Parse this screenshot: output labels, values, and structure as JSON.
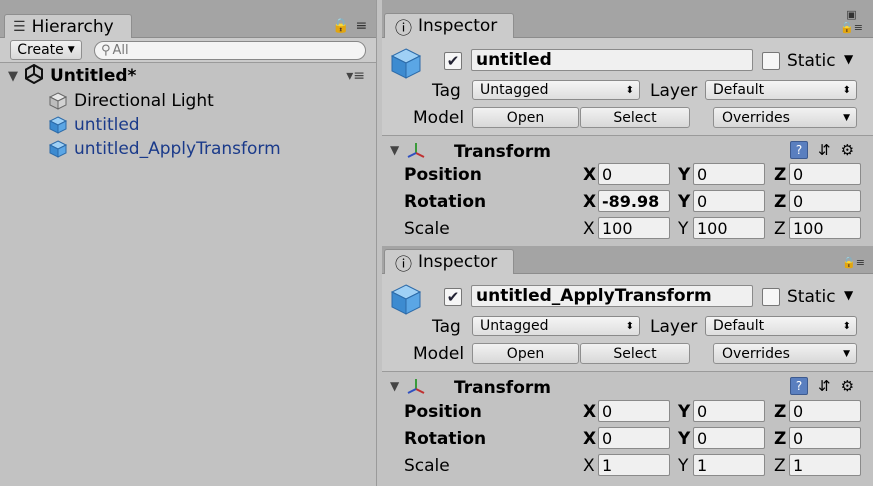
{
  "hierarchy": {
    "tab_label": "Hierarchy",
    "create_label": "Create",
    "search_placeholder": "All",
    "scene_name": "Untitled*",
    "items": [
      {
        "label": "Directional Light"
      },
      {
        "label": "untitled"
      },
      {
        "label": "untitled_ApplyTransform"
      }
    ]
  },
  "inspectors": [
    {
      "tab_label": "Inspector",
      "name": "untitled",
      "active": true,
      "static_label": "Static",
      "tag_label": "Tag",
      "tag_value": "Untagged",
      "layer_label": "Layer",
      "layer_value": "Default",
      "model_label": "Model",
      "open_label": "Open",
      "select_label": "Select",
      "overrides_label": "Overrides",
      "transform_title": "Transform",
      "position_label": "Position",
      "rotation_label": "Rotation",
      "scale_label": "Scale",
      "axis": {
        "x": "X",
        "y": "Y",
        "z": "Z"
      },
      "position": {
        "x": "0",
        "y": "0",
        "z": "0"
      },
      "rotation": {
        "x": "-89.98",
        "y": "0",
        "z": "0"
      },
      "scale": {
        "x": "100",
        "y": "100",
        "z": "100"
      }
    },
    {
      "tab_label": "Inspector",
      "name": "untitled_ApplyTransform",
      "active": true,
      "static_label": "Static",
      "tag_label": "Tag",
      "tag_value": "Untagged",
      "layer_label": "Layer",
      "layer_value": "Default",
      "model_label": "Model",
      "open_label": "Open",
      "select_label": "Select",
      "overrides_label": "Overrides",
      "transform_title": "Transform",
      "position_label": "Position",
      "rotation_label": "Rotation",
      "scale_label": "Scale",
      "axis": {
        "x": "X",
        "y": "Y",
        "z": "Z"
      },
      "position": {
        "x": "0",
        "y": "0",
        "z": "0"
      },
      "rotation": {
        "x": "0",
        "y": "0",
        "z": "0"
      },
      "scale": {
        "x": "1",
        "y": "1",
        "z": "1"
      }
    }
  ],
  "colors": {
    "prefab_blue": "#1a3a8a",
    "cube_blue": "#4a9ad8"
  }
}
